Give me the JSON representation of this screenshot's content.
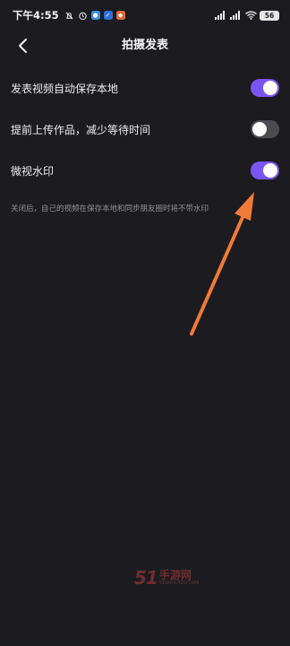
{
  "status_bar": {
    "time": "下午4:55",
    "battery": "56",
    "icons": [
      "alarm-muted-icon",
      "alarm-icon",
      "app-icon-blue",
      "app-icon-blue2",
      "app-icon-orange",
      "signal-icon",
      "signal-icon-2",
      "wifi-icon",
      "battery-icon"
    ]
  },
  "nav": {
    "title": "拍摄发表",
    "back_icon": "chevron-left-icon"
  },
  "settings": [
    {
      "label": "发表视频自动保存本地",
      "enabled": true
    },
    {
      "label": "提前上传作品，减少等待时间",
      "enabled": false
    },
    {
      "label": "微视水印",
      "enabled": true
    }
  ],
  "note": "关闭后，自己的视频在保存本地和同步朋友圈时将不带水印",
  "annotation": {
    "arrow_color": "#f07a3a"
  },
  "watermark": {
    "number": "51",
    "text": "手游网",
    "url": "51SHOUYOU.COM"
  },
  "colors": {
    "background": "#1c1c20",
    "toggle_on": "#7b55f2",
    "toggle_off": "#4b4b52"
  }
}
